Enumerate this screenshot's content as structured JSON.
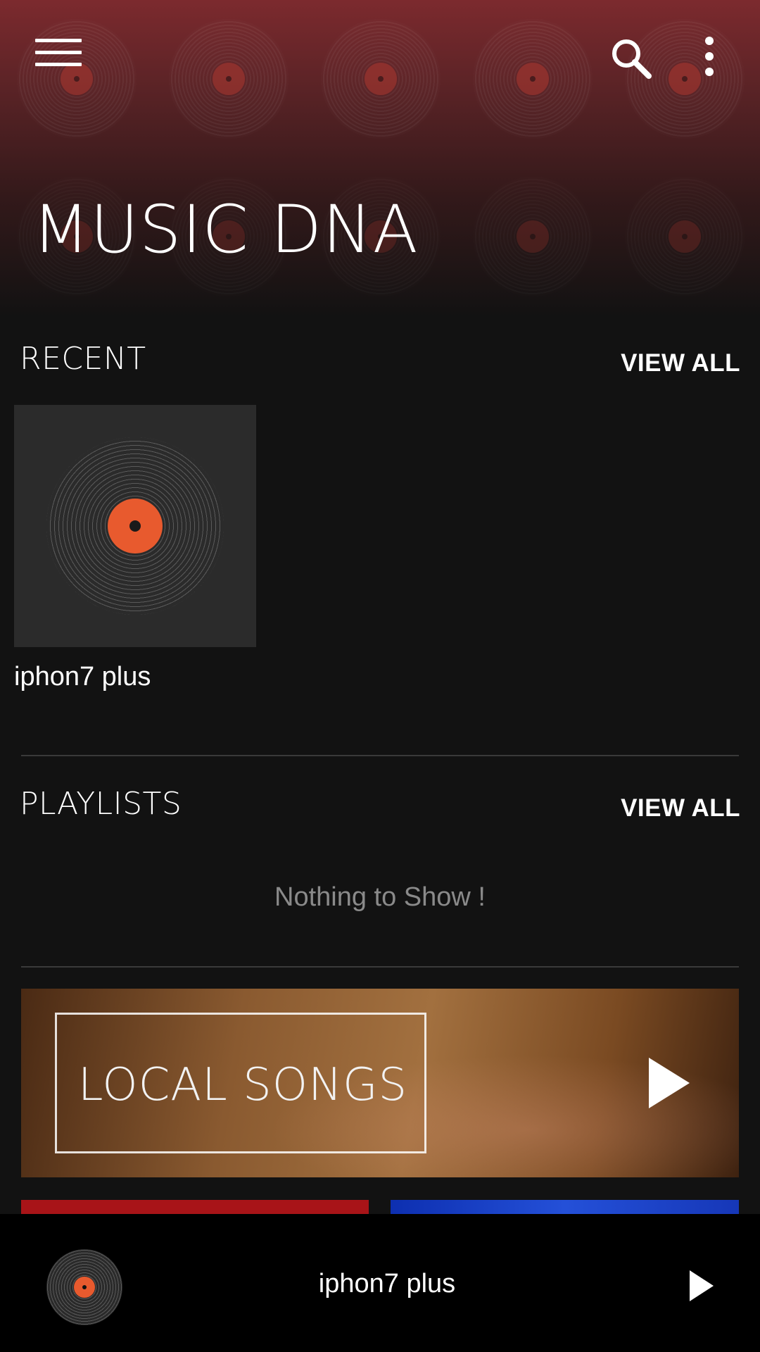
{
  "app": {
    "title": "MUSIC DNA"
  },
  "header": {
    "menu_icon": "hamburger-menu-icon",
    "search_icon": "search-icon",
    "more_icon": "more-vert-icon"
  },
  "recent": {
    "title": "RECENT",
    "view_all": "VIEW ALL",
    "items": [
      {
        "name": "iphon7 plus"
      }
    ]
  },
  "playlists": {
    "title": "PLAYLISTS",
    "view_all": "VIEW ALL",
    "empty_text": "Nothing to Show !"
  },
  "local_songs": {
    "label": "LOCAL SONGS",
    "play_icon": "play-icon"
  },
  "player": {
    "title": "iphon7 plus",
    "play_icon": "play-icon"
  },
  "colors": {
    "accent": "#e85a2e",
    "header_top": "#7c2a2e",
    "background": "#121212"
  }
}
